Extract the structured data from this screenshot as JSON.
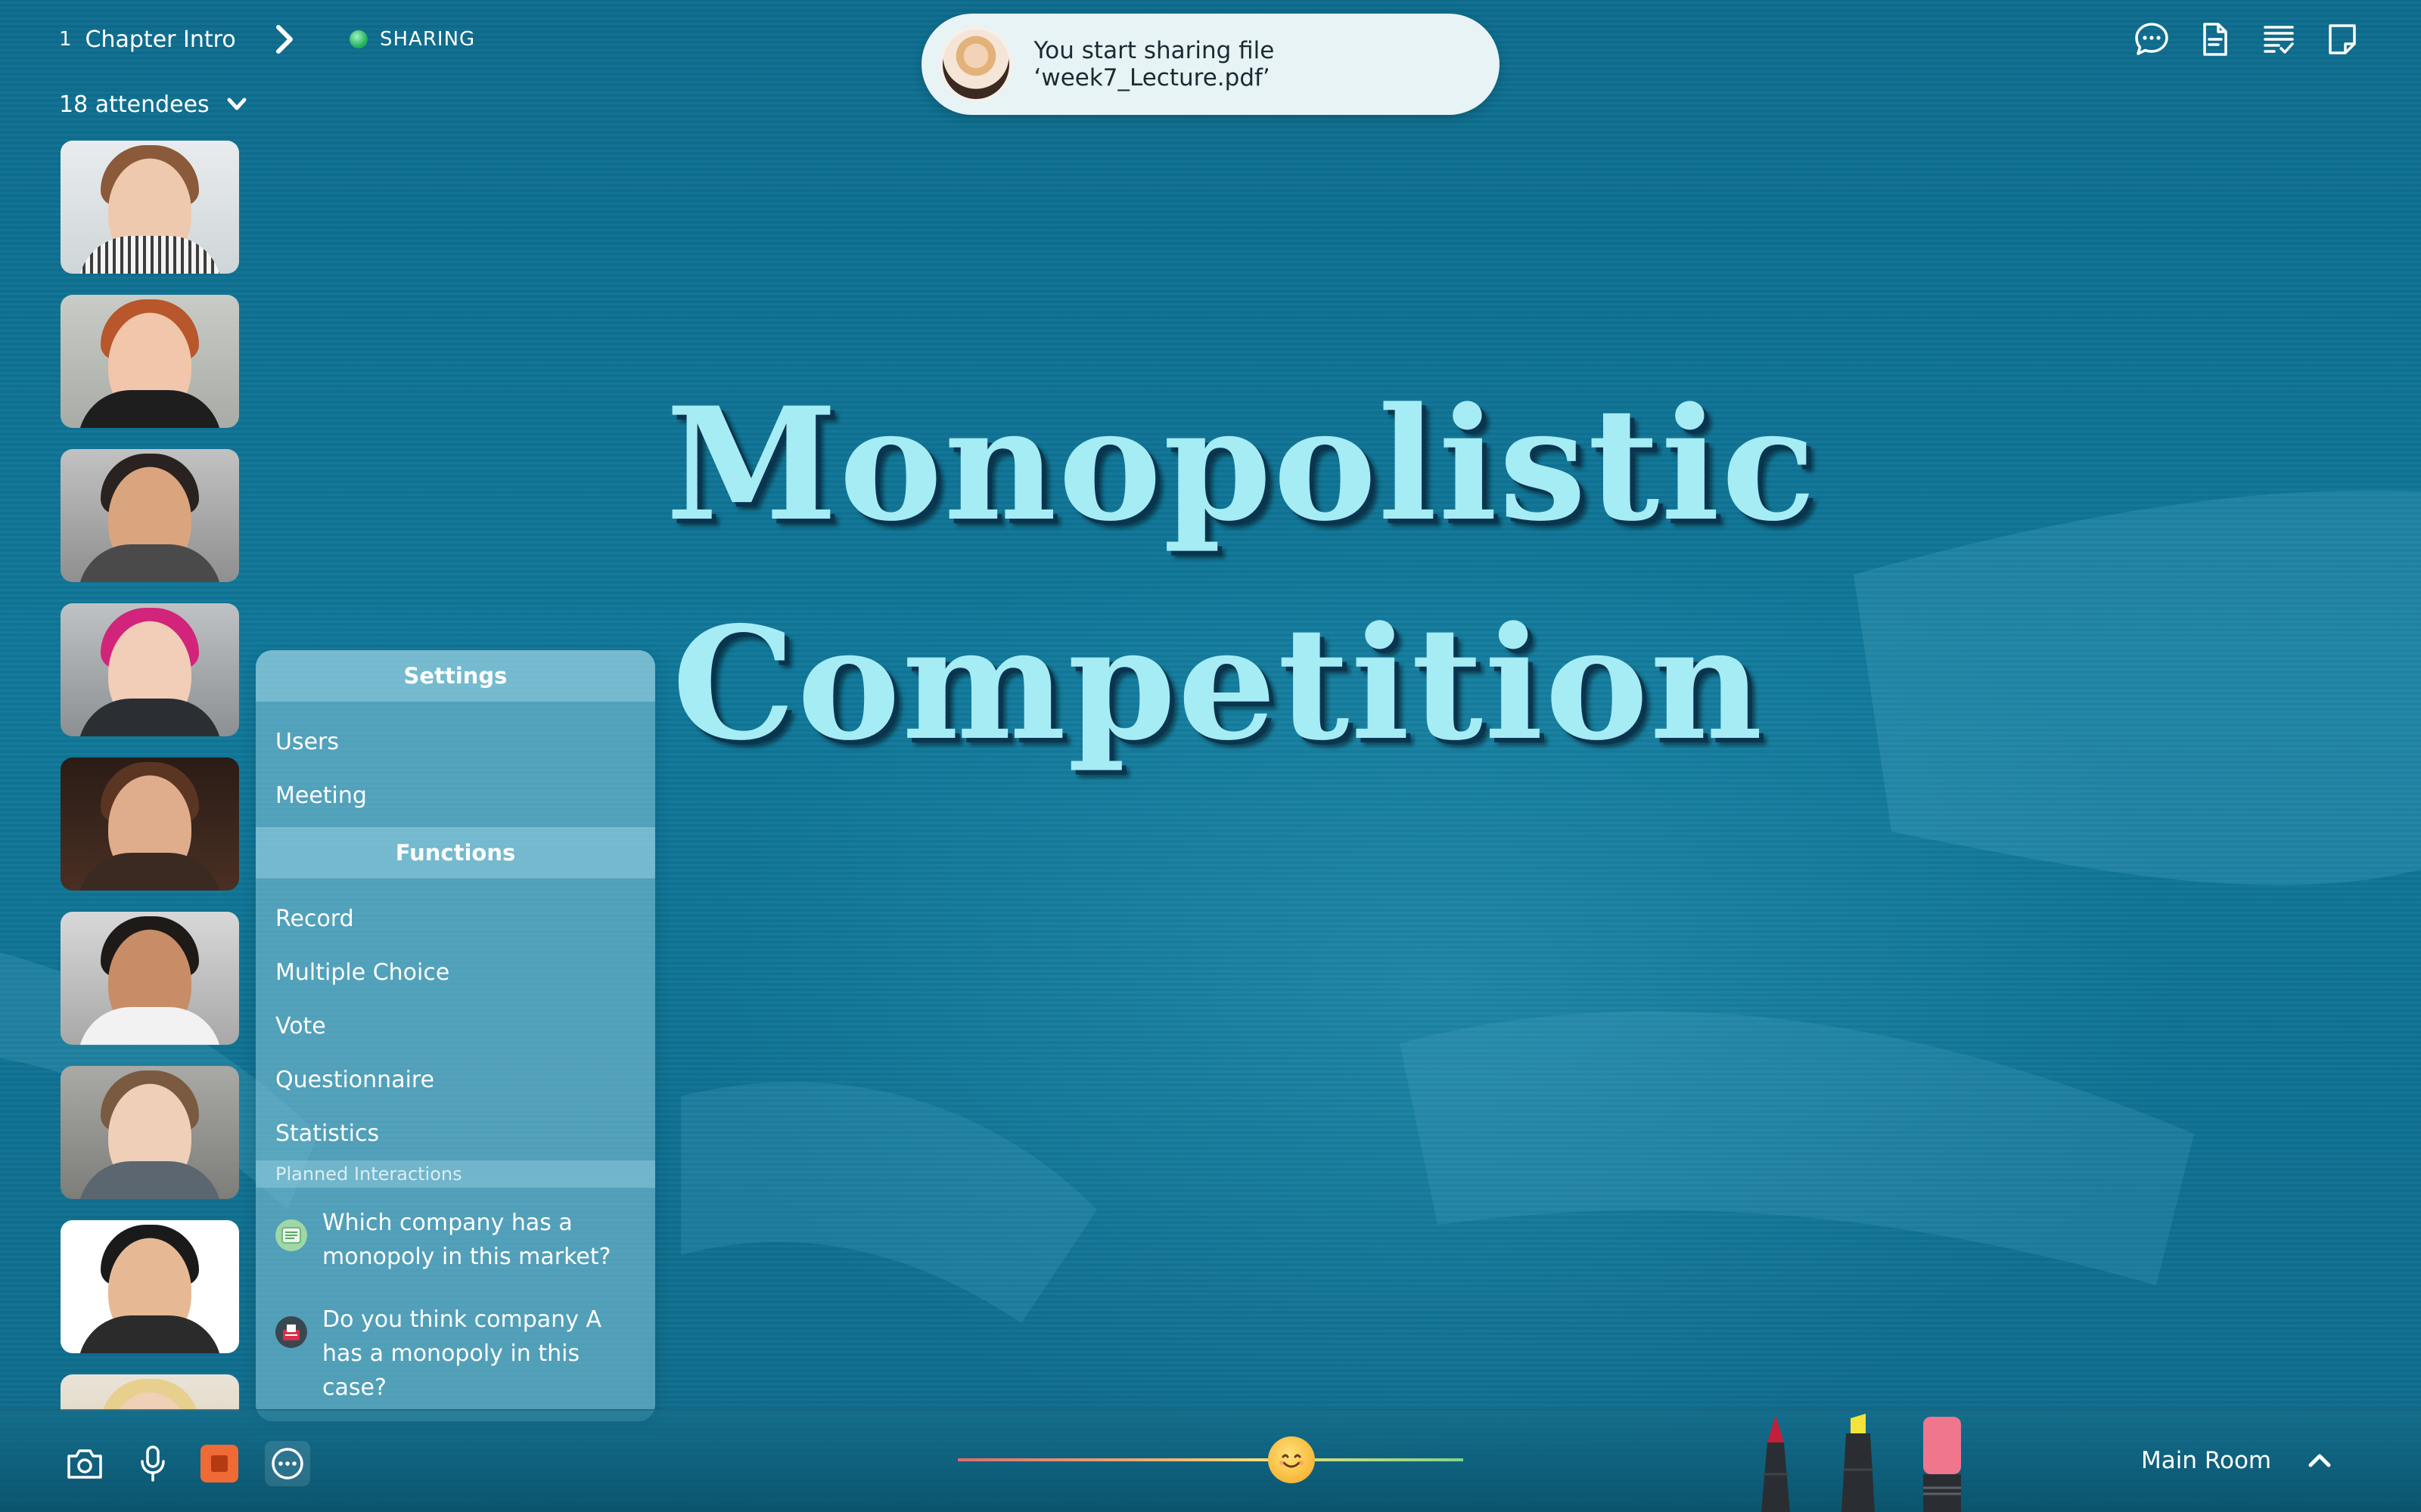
{
  "header": {
    "chapter_number": "1",
    "chapter_title": "Chapter Intro",
    "sharing_label": "SHARING",
    "attendees_label": "18 attendees"
  },
  "toast": {
    "message": "You start sharing file ‘week7_Lecture.pdf’"
  },
  "top_tools": [
    "chat-icon",
    "document-icon",
    "checklist-icon",
    "note-icon"
  ],
  "slide": {
    "title_line1": "Monopolistic",
    "title_line2": "Competition"
  },
  "settings_menu": {
    "settings_heading": "Settings",
    "settings_items": [
      "Users",
      "Meeting"
    ],
    "functions_heading": "Functions",
    "function_items": [
      "Record",
      "Multiple Choice",
      "Vote",
      "Questionnaire",
      "Statistics"
    ],
    "planned_heading": "Planned Interactions",
    "planned_items": [
      {
        "icon": "list-icon",
        "text": "Which company has a monopoly in this market?"
      },
      {
        "icon": "vote-icon",
        "text": "Do you think company A has a monopoly in this case?"
      }
    ]
  },
  "bottom_bar": {
    "room_label": "Main Room",
    "controls": [
      "camera-icon",
      "microphone-icon",
      "record-icon",
      "more-icon"
    ],
    "pens": [
      "red-pen",
      "yellow-highlighter",
      "pink-eraser"
    ]
  },
  "colors": {
    "slide_background": "#0f6c8c",
    "title_color": "#a6ecf5",
    "record_accent": "#f06a35",
    "sharing_dot": "#28b462"
  }
}
